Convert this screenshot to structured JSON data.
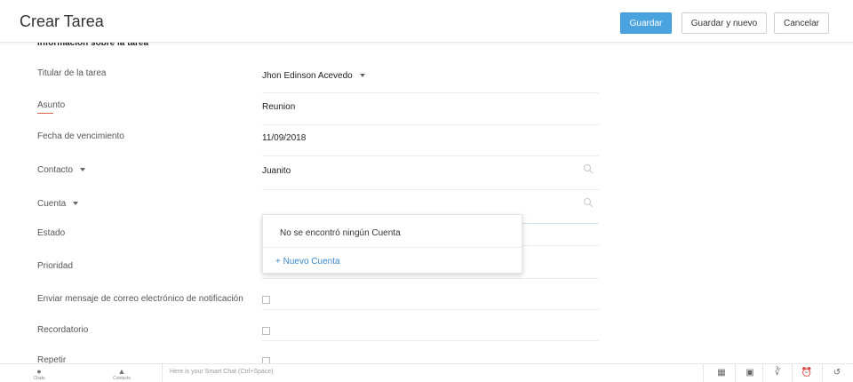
{
  "header": {
    "title": "Crear Tarea",
    "save_label": "Guardar",
    "save_new_label": "Guardar y nuevo",
    "cancel_label": "Cancelar"
  },
  "form": {
    "section_title": "Información sobre la tarea",
    "owner_label": "Titular de la tarea",
    "owner_value": "Jhon Edinson Acevedo",
    "subject_label": "Asunto",
    "subject_value": "Reunion",
    "due_label": "Fecha de vencimiento",
    "due_value": "11/09/2018",
    "contact_label": "Contacto",
    "contact_value": "Juanito",
    "account_label": "Cuenta",
    "account_value": "",
    "status_label": "Estado",
    "priority_label": "Prioridad",
    "notify_label": "Enviar mensaje de correo electrónico de notificación",
    "reminder_label": "Recordatorio",
    "repeat_label": "Repetir"
  },
  "dropdown": {
    "empty_message": "No se encontró ningún Cuenta",
    "new_link": "+ Nuevo Cuenta"
  },
  "bottombar": {
    "chats_label": "Chats",
    "contacts_label": "Contacts",
    "smartchat_placeholder": "Here is your Smart Chat (Ctrl+Space)"
  },
  "colors": {
    "primary": "#4aa3df",
    "link": "#3a87c8",
    "accent_underline": "#e0604e"
  }
}
